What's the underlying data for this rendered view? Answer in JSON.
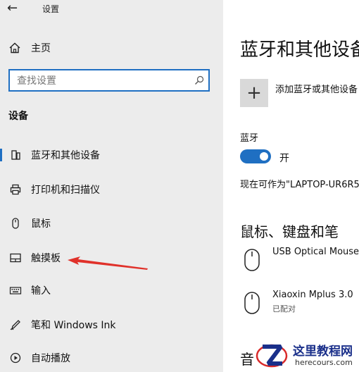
{
  "window": {
    "title": "设置"
  },
  "sidebar": {
    "home_label": "主页",
    "search_placeholder": "查找设置",
    "section_heading": "设备",
    "items": [
      {
        "label": "蓝牙和其他设备",
        "icon": "bluetooth-device-icon",
        "selected": true
      },
      {
        "label": "打印机和扫描仪",
        "icon": "printer-icon",
        "selected": false
      },
      {
        "label": "鼠标",
        "icon": "mouse-icon",
        "selected": false
      },
      {
        "label": "触摸板",
        "icon": "touchpad-icon",
        "selected": false
      },
      {
        "label": "输入",
        "icon": "keyboard-icon",
        "selected": false
      },
      {
        "label": "笔和 Windows Ink",
        "icon": "pen-icon",
        "selected": false
      },
      {
        "label": "自动播放",
        "icon": "autoplay-icon",
        "selected": false
      }
    ]
  },
  "main": {
    "title": "蓝牙和其他设备",
    "add_device_label": "添加蓝牙或其他设备",
    "bluetooth_label": "蓝牙",
    "bluetooth_state": "开",
    "discoverable_text": "现在可作为\"LAPTOP-UR6R5",
    "mouse_keyboard_pen_heading": "鼠标、键盘和笔",
    "devices": [
      {
        "name": "USB Optical Mouse",
        "status": ""
      },
      {
        "name": "Xiaoxin Mplus 3.0",
        "status": "已配对"
      }
    ],
    "audio_heading": "音"
  },
  "watermark": {
    "title": "这里教程网",
    "url": "herecours.com"
  },
  "colors": {
    "accent": "#1f6fc2",
    "sidebar_bg": "#ececec",
    "annotation_arrow": "#e0312a"
  }
}
